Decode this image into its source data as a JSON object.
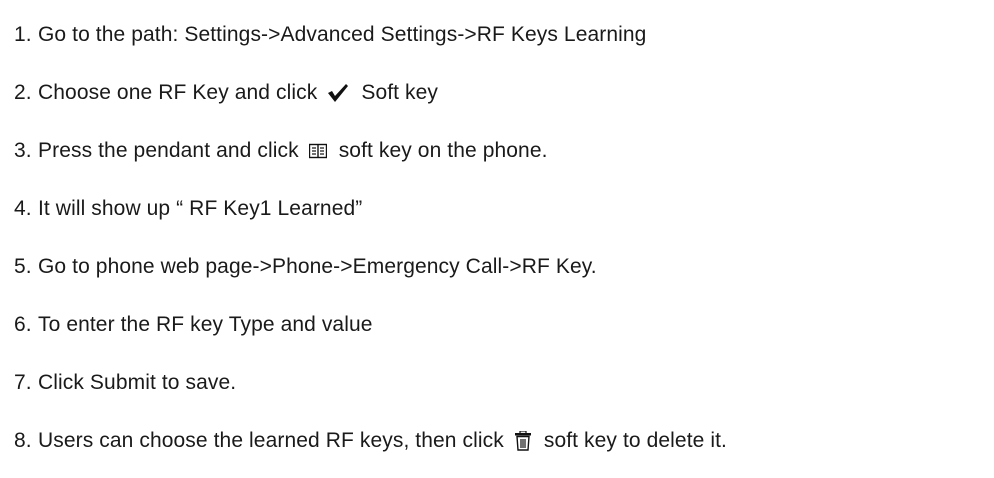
{
  "steps": [
    {
      "num": "1.",
      "text": "Go to the path: Settings->Advanced Settings->RF Keys Learning"
    },
    {
      "num": "2.",
      "before": "Choose one RF Key and click",
      "icon": "checkmark-icon",
      "after": "Soft key"
    },
    {
      "num": "3.",
      "before": "Press the pendant and click",
      "icon": "book-icon",
      "after": "soft key on the phone."
    },
    {
      "num": "4.",
      "text": "It will show up “ RF Key1 Learned”"
    },
    {
      "num": "5.",
      "text": "Go to phone web page->Phone->Emergency Call->RF Key."
    },
    {
      "num": "6.",
      "text": "To enter the RF key Type and value"
    },
    {
      "num": "7.",
      "text": "Click Submit to save."
    },
    {
      "num": "8.",
      "before": "Users can choose the learned RF keys, then click",
      "icon": "trash-icon",
      "after": "soft key to delete it."
    }
  ]
}
